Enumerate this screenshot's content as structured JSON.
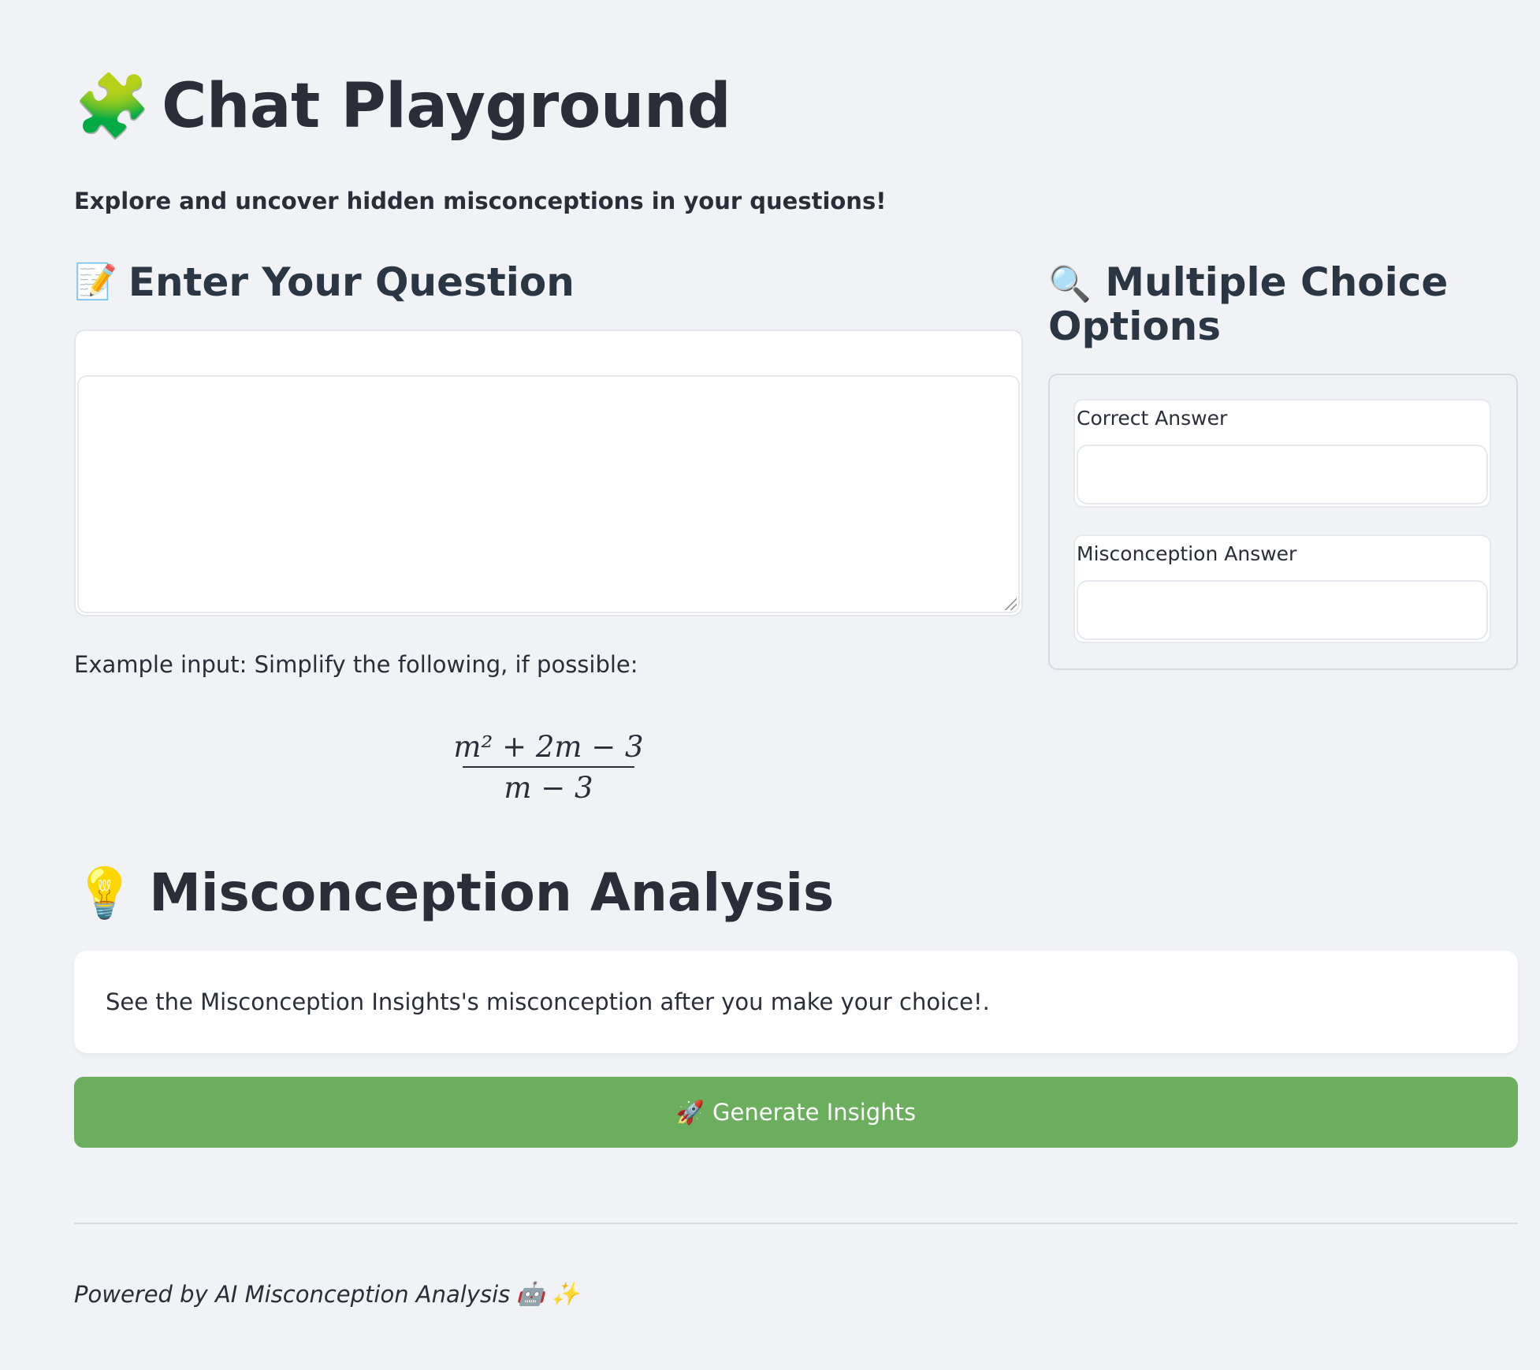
{
  "header": {
    "icon": "puzzle-piece-icon",
    "icon_glyph": "🧩",
    "title": "Chat Playground",
    "subtitle": "Explore and uncover hidden misconceptions in your questions!"
  },
  "question_section": {
    "icon": "memo-icon",
    "icon_glyph": "📝",
    "heading": "Enter Your Question",
    "textarea_value": "",
    "example_text": "Example input: Simplify the following, if possible:",
    "formula_numerator": "m² + 2m − 3",
    "formula_denominator": "m − 3"
  },
  "options_section": {
    "icon": "magnifier-icon",
    "icon_glyph": "🔍",
    "heading": "Multiple Choice Options",
    "correct_label": "Correct Answer",
    "correct_value": "",
    "misconception_label": "Misconception Answer",
    "misconception_value": ""
  },
  "analysis_section": {
    "icon": "lightbulb-icon",
    "icon_glyph": "💡",
    "heading": "Misconception Analysis",
    "message": "See the Misconception Insights's misconception after you make your choice!."
  },
  "generate_button": {
    "icon": "rocket-icon",
    "icon_glyph": "🚀",
    "label": "Generate Insights",
    "color": "#6aae5e"
  },
  "footer": {
    "text": "Powered by AI Misconception Analysis",
    "robot_glyph": "🤖",
    "sparkles_glyph": "✨"
  },
  "colors": {
    "background": "#f0f2f6",
    "text": "#2b2d38",
    "heading": "#2b3645"
  }
}
